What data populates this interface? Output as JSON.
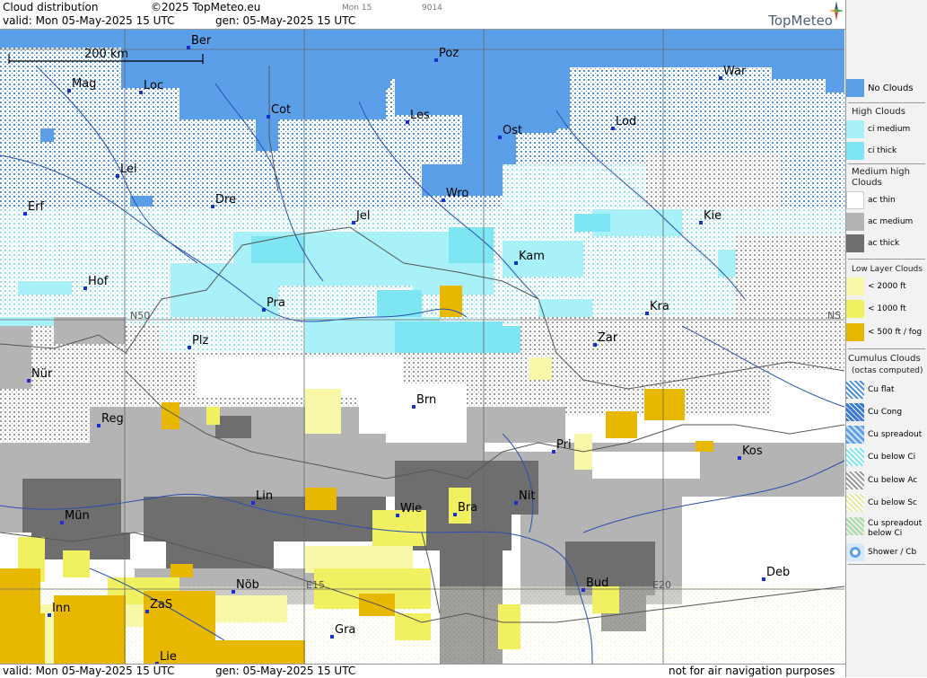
{
  "header": {
    "title": "Cloud distribution",
    "copyright": "©2025 TopMeteo.eu",
    "valid": "valid:  Mon  05-May-2025  15 UTC",
    "gen": "gen:  05-May-2025  15 UTC",
    "small_day": "Mon 15",
    "small_code": "9014",
    "logo": "TopMeteo"
  },
  "footer": {
    "valid": "valid:  Mon  05-May-2025  15 UTC",
    "gen": "gen:  05-May-2025  15 UTC",
    "disclaimer": "not for air navigation purposes"
  },
  "map": {
    "scale_label": "200 km",
    "grid_labels": [
      "N50",
      "N5",
      "E15",
      "E20"
    ],
    "cities": [
      {
        "name": "Ber"
      },
      {
        "name": "Poz"
      },
      {
        "name": "War"
      },
      {
        "name": "Mag"
      },
      {
        "name": "Loc"
      },
      {
        "name": "Cot"
      },
      {
        "name": "Les"
      },
      {
        "name": "Ost"
      },
      {
        "name": "Lod"
      },
      {
        "name": "Lei"
      },
      {
        "name": "Erf"
      },
      {
        "name": "Dre"
      },
      {
        "name": "Wro"
      },
      {
        "name": "Jel"
      },
      {
        "name": "Kie"
      },
      {
        "name": "Kam"
      },
      {
        "name": "Hof"
      },
      {
        "name": "Pra"
      },
      {
        "name": "Kra"
      },
      {
        "name": "Plz"
      },
      {
        "name": "Zar"
      },
      {
        "name": "Nür"
      },
      {
        "name": "Brn"
      },
      {
        "name": "Reg"
      },
      {
        "name": "Pri"
      },
      {
        "name": "Kos"
      },
      {
        "name": "Lin"
      },
      {
        "name": "Nit"
      },
      {
        "name": "Mün"
      },
      {
        "name": "Wie"
      },
      {
        "name": "Bra"
      },
      {
        "name": "Deb"
      },
      {
        "name": "Nöb"
      },
      {
        "name": "Bud"
      },
      {
        "name": "Inn"
      },
      {
        "name": "ZaS"
      },
      {
        "name": "Gra"
      },
      {
        "name": "Lie"
      }
    ]
  },
  "legend": {
    "no_clouds": "No Clouds",
    "high_title": "High Clouds",
    "ci_medium": "ci medium",
    "ci_thick": "ci thick",
    "medium_title": "Medium high Clouds",
    "ac_thin": "ac thin",
    "ac_medium": "ac medium",
    "ac_thick": "ac thick",
    "low_title": "Low Layer Clouds",
    "low_2000": "< 2000 ft",
    "low_1000": "< 1000 ft",
    "low_500": "< 500 ft / fog",
    "cu_title": "Cumulus Clouds",
    "cu_sub": "(octas computed)",
    "cu_flat": "Cu flat",
    "cu_cong": "Cu Cong",
    "cu_spreadout": "Cu spreadout",
    "cu_below_ci": "Cu below Ci",
    "cu_below_ac": "Cu below Ac",
    "cu_below_sc": "Cu below Sc",
    "cu_spread_below_ci": "Cu spreadout below Ci",
    "shower": "Shower / Cb"
  },
  "colors": {
    "no_clouds": "#5b9fe8",
    "ci_medium": "#a9f1f9",
    "ci_thick": "#7ee6f2",
    "ac_thin": "#ffffff",
    "ac_medium": "#b4b4b4",
    "ac_thick": "#6e6e6e",
    "low_2000": "#f8f8a8",
    "low_1000": "#f0f060",
    "low_500": "#e8b800"
  }
}
